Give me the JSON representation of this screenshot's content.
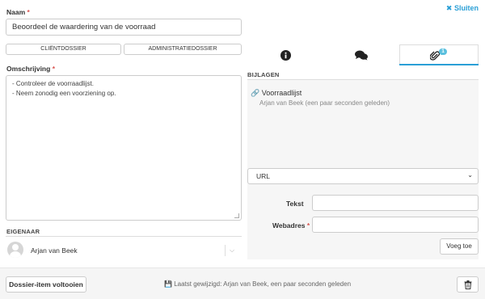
{
  "header": {
    "close_label": "Sluiten"
  },
  "name_field": {
    "label": "Naam",
    "required_mark": "*",
    "value": "Beoordeel de waardering van de voorraad"
  },
  "dossier_buttons": {
    "client": "CLIËNTDOSSIER",
    "admin": "ADMINISTRATIEDOSSIER"
  },
  "description": {
    "label": "Omschrijving",
    "required_mark": "*",
    "lines": [
      "- Controleer de voorraadlijst.",
      "- Neem zonodig een voorziening op."
    ]
  },
  "owner": {
    "heading": "EIGENAAR",
    "name": "Arjan van Beek"
  },
  "tabs": {
    "attachments_badge": "1"
  },
  "attachments": {
    "heading": "BIJLAGEN",
    "items": [
      {
        "title": "Voorraadlijst",
        "meta": "Arjan van Beek (een paar seconden geleden)"
      }
    ]
  },
  "url_form": {
    "type_select": "URL",
    "text_label": "Tekst",
    "text_value": "",
    "url_label": "Webadres",
    "url_required_mark": "*",
    "url_value": "",
    "add_button": "Voeg toe"
  },
  "footer": {
    "complete_button": "Dossier-item voltooien",
    "last_modified": "Laatst gewijzigd: Arjan van Beek, een paar seconden geleden"
  },
  "colors": {
    "accent": "#2a9fd6",
    "badge": "#5bc0de"
  }
}
